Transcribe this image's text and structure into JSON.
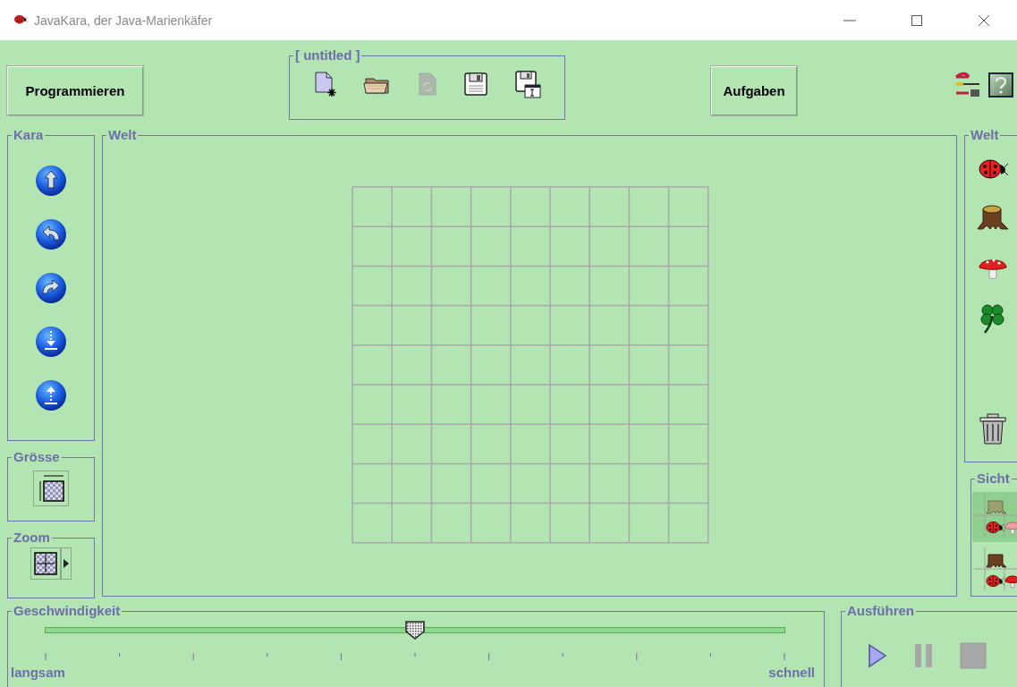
{
  "window": {
    "title": "JavaKara, der Java-Marienkäfer"
  },
  "toolbar": {
    "program_button": "Programmieren",
    "file_group": {
      "title": "[ untitled ]",
      "tools": [
        {
          "kind": "new",
          "disabled": false
        },
        {
          "kind": "open",
          "disabled": false
        },
        {
          "kind": "reload",
          "disabled": true
        },
        {
          "kind": "save",
          "disabled": false
        },
        {
          "kind": "saveas",
          "disabled": false
        }
      ]
    },
    "tasks_button": "Aufgaben"
  },
  "kara_panel": {
    "title": "Kara",
    "commands": [
      {
        "kind": "forward"
      },
      {
        "kind": "left"
      },
      {
        "kind": "right"
      },
      {
        "kind": "put"
      },
      {
        "kind": "take"
      }
    ]
  },
  "size_panel": {
    "title": "Grösse"
  },
  "zoom_panel": {
    "title": "Zoom"
  },
  "world": {
    "title": "Welt"
  },
  "palette": {
    "title": "Welt",
    "objects": [
      {
        "kind": "ladybug"
      },
      {
        "kind": "stump"
      },
      {
        "kind": "mushroom"
      },
      {
        "kind": "clover"
      },
      {
        "kind": "trash"
      }
    ]
  },
  "view_panel": {
    "title": "Sicht",
    "views": [
      {
        "selected": true
      },
      {
        "selected": false
      }
    ]
  },
  "speed": {
    "title": "Geschwindigkeit",
    "level": 0.5,
    "min_label": "langsam",
    "max_label": "schnell"
  },
  "run_panel": {
    "title": "Ausführen",
    "controls": [
      {
        "kind": "play",
        "disabled": false
      },
      {
        "kind": "pause",
        "disabled": true
      },
      {
        "kind": "stop",
        "disabled": true
      }
    ]
  }
}
